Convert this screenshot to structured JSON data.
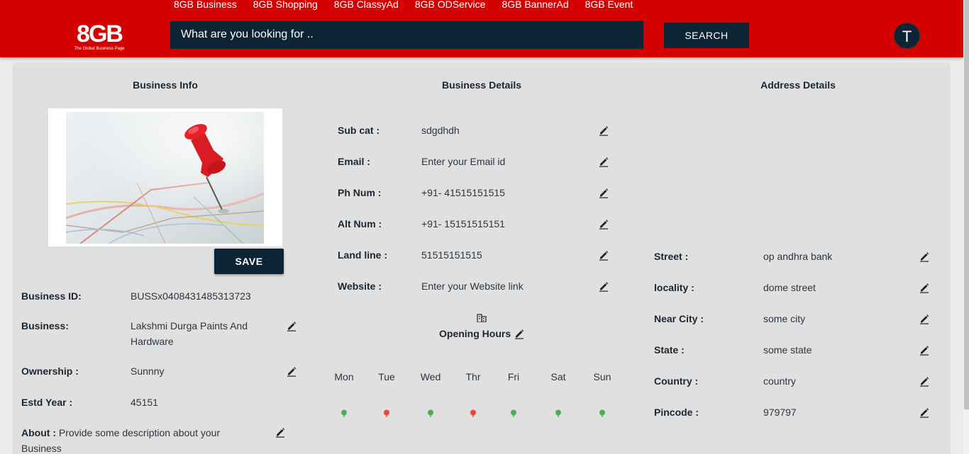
{
  "topnav": [
    "8GB Business",
    "8GB Shopping",
    "8GB ClassyAd",
    "8GB ODService",
    "8GB BannerAd",
    "8GB Event"
  ],
  "logo": {
    "main": "8GB",
    "tagline": "The Global Business Page"
  },
  "search": {
    "placeholder": "What are you looking for ..",
    "button": "SEARCH"
  },
  "user": {
    "initial": "T"
  },
  "business_info": {
    "title": "Business Info",
    "save_label": "SAVE",
    "fields": [
      {
        "label": "Business ID:",
        "value": "BUSSx0408431485313723"
      },
      {
        "label": "Business:",
        "value": "Lakshmi Durga Paints And Hardware"
      },
      {
        "label": "Ownership :",
        "value": "Sunnny"
      },
      {
        "label": "Estd Year :",
        "value": "45151"
      }
    ],
    "about_label": "About :",
    "about_value": "Provide some description about your Business"
  },
  "business_details": {
    "title": "Business Details",
    "fields": [
      {
        "label": "Sub cat :",
        "value": "sdgdhdh"
      },
      {
        "label": "Email :",
        "value": "Enter your Email id"
      },
      {
        "label": "Ph Num :",
        "value": "+91- 41515151515"
      },
      {
        "label": "Alt Num :",
        "value": "+91- 15151515151"
      },
      {
        "label": "Land line :",
        "value": "51515151515"
      },
      {
        "label": "Website :",
        "value": "Enter your Website link"
      }
    ],
    "opening_hours_title": "Opening Hours",
    "days": [
      {
        "name": "Mon",
        "open": true
      },
      {
        "name": "Tue",
        "open": false
      },
      {
        "name": "Wed",
        "open": true
      },
      {
        "name": "Thr",
        "open": false
      },
      {
        "name": "Fri",
        "open": true
      },
      {
        "name": "Sat",
        "open": true
      },
      {
        "name": "Sun",
        "open": true
      }
    ]
  },
  "address_details": {
    "title": "Address Details",
    "fields": [
      {
        "label": "Street :",
        "value": "op andhra bank"
      },
      {
        "label": "locality :",
        "value": "dome street"
      },
      {
        "label": "Near City :",
        "value": "some city"
      },
      {
        "label": "State :",
        "value": "some state"
      },
      {
        "label": "Country :",
        "value": "country"
      },
      {
        "label": "Pincode :",
        "value": "979797"
      }
    ]
  },
  "colors": {
    "header": "#d50000",
    "dark": "#0c2434",
    "open": "#4caf50",
    "closed": "#f44336"
  },
  "icons": {
    "edit": "edit-pencil-icon",
    "hours": "building-icon",
    "day_status": "map-pin-icon"
  }
}
